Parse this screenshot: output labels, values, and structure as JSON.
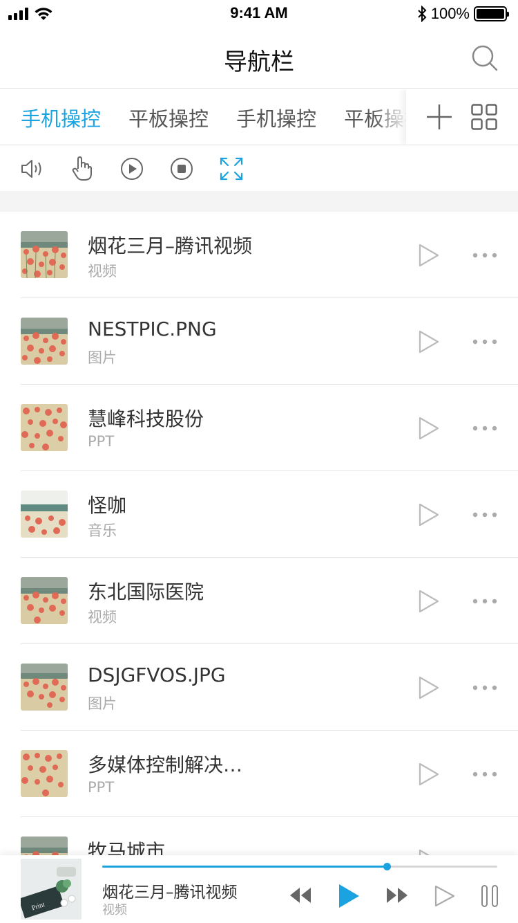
{
  "status_bar": {
    "time": "9:41 AM",
    "battery_text": "100%"
  },
  "nav": {
    "title": "导航栏",
    "search_icon": "search-icon"
  },
  "tabs": {
    "items": [
      {
        "label": "手机操控",
        "active": true
      },
      {
        "label": "平板操控",
        "active": false
      },
      {
        "label": "手机操控",
        "active": false
      },
      {
        "label": "平板操控",
        "active": false
      }
    ],
    "add_icon": "plus-icon",
    "grid_icon": "grid-icon"
  },
  "toolbar": {
    "icons": [
      "volume-icon",
      "touch-hand-icon",
      "play-circle-icon",
      "stop-circle-icon",
      "fullscreen-icon"
    ],
    "accent": "#1aa3e0"
  },
  "list": {
    "items": [
      {
        "title": "烟花三月–腾讯视频",
        "type": "视频"
      },
      {
        "title": "NESTPIC.PNG",
        "type": "图片"
      },
      {
        "title": "慧峰科技股份",
        "type": "PPT"
      },
      {
        "title": "怪咖",
        "type": "音乐"
      },
      {
        "title": "东北国际医院",
        "type": "视频"
      },
      {
        "title": "DSJGFVOS.JPG",
        "type": "图片"
      },
      {
        "title": "多媒体控制解决…",
        "type": "PPT"
      },
      {
        "title": "牧马城市",
        "type": ""
      }
    ]
  },
  "player": {
    "title": "烟花三月–腾讯视频",
    "type": "视频",
    "progress": 0.72,
    "icons": [
      "rewind-icon",
      "play-icon",
      "fast-forward-icon",
      "play-outline-icon",
      "pause-icon"
    ]
  },
  "colors": {
    "accent": "#1aa3e0",
    "text": "#333333",
    "muted": "#aaaaaa",
    "divider": "#e4e4e4"
  }
}
